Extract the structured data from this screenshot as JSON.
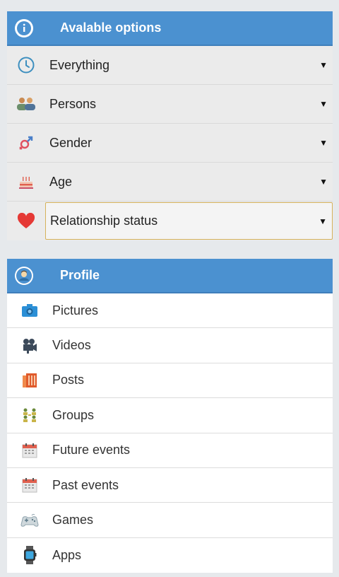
{
  "options": {
    "title": "Avalable options",
    "header_icon": "info-icon",
    "items": [
      {
        "label": "Everything",
        "icon": "clock-icon"
      },
      {
        "label": "Persons",
        "icon": "persons-icon"
      },
      {
        "label": "Gender",
        "icon": "gender-icon"
      },
      {
        "label": "Age",
        "icon": "birthday-cake-icon"
      },
      {
        "label": "Relationship status",
        "icon": "heart-icon",
        "focused": true
      }
    ],
    "dropdown_arrow": "▼"
  },
  "profile": {
    "title": "Profile",
    "header_icon": "user-avatar-icon",
    "items": [
      {
        "label": "Pictures",
        "icon": "camera-icon"
      },
      {
        "label": "Videos",
        "icon": "video-camera-icon"
      },
      {
        "label": "Posts",
        "icon": "posts-icon"
      },
      {
        "label": "Groups",
        "icon": "groups-icon"
      },
      {
        "label": "Future events",
        "icon": "calendar-icon"
      },
      {
        "label": "Past events",
        "icon": "calendar-icon"
      },
      {
        "label": "Games",
        "icon": "gamepad-icon"
      },
      {
        "label": "Apps",
        "icon": "smartwatch-icon"
      }
    ]
  },
  "colors": {
    "header_blue": "#4b91d0",
    "focus_border": "#d6b25b",
    "background": "#e6e9ec"
  }
}
